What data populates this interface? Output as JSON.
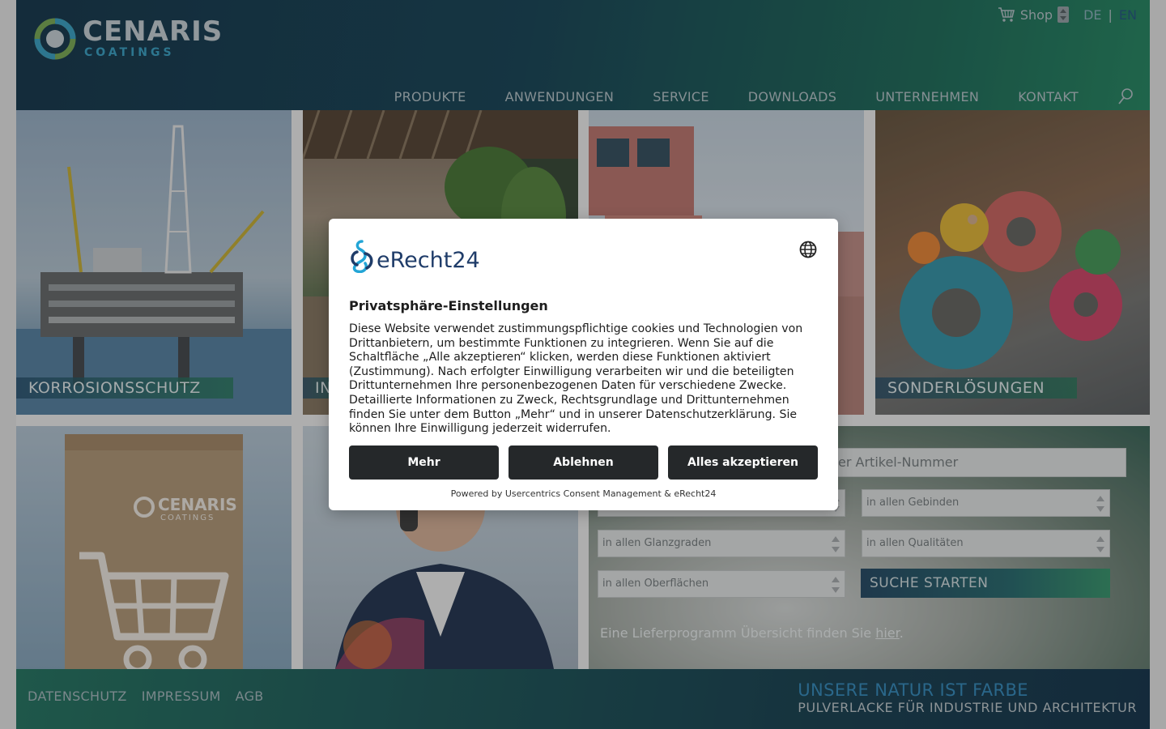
{
  "brand": {
    "name": "CENARIS",
    "sub": "COATINGS",
    "colors": {
      "header_dark": "#1d3d52",
      "header_green": "#2c8c68",
      "accent_blue": "#3b8fc0"
    }
  },
  "topbar": {
    "shop_label": "Shop",
    "lang_de": "DE",
    "lang_sep": "|",
    "lang_en": "EN"
  },
  "nav": {
    "items": [
      "PRODUKTE",
      "ANWENDUNGEN",
      "SERVICE",
      "DOWNLOADS",
      "UNTERNEHMEN",
      "KONTAKT"
    ]
  },
  "tiles": {
    "korrosion": "KORROSIONSSCHUTZ",
    "innen_partial": "IN",
    "sonder": "SONDERLÖSUNGEN",
    "box_brand": "CENARIS",
    "box_sub": "COATINGS"
  },
  "search": {
    "main_placeholder_visible": "ne oder Artikel-Nummer",
    "gebinde": "in allen Gebinden",
    "glanz": "in allen Glanzgraden",
    "qualitaet": "in allen Qualitäten",
    "oberflaeche": "in allen Oberflächen",
    "button": "SUCHE STARTEN",
    "note_prefix": "Eine Lieferprogramm Übersicht finden Sie ",
    "note_link": "hier",
    "note_suffix": "."
  },
  "footer": {
    "links": [
      "DATENSCHUTZ",
      "IMPRESSUM",
      "AGB"
    ],
    "slogan_1": "UNSERE NATUR IST FARBE",
    "slogan_2": "PULVERLACKE FÜR INDUSTRIE UND ARCHITEKTUR"
  },
  "consent": {
    "logo_text": "eRecht24",
    "title": "Privatsphäre-Einstellungen",
    "body": "Diese Website verwendet zustimmungspflichtige cookies und Technologien von Drittanbietern, um bestimmte Funktionen zu integrieren. Wenn Sie auf die Schaltfläche „Alle akzeptieren“ klicken, werden diese Funktionen aktiviert (Zustimmung). Nach erfolgter Einwilligung verarbeiten wir und die beteiligten Drittunternehmen Ihre personenbezogenen Daten für verschiedene Zwecke. Detaillierte Informationen zu Zweck, Rechtsgrundlage und Drittunternehmen finden Sie unter dem Button „Mehr“ und in unserer Datenschutzerklärung. Sie können Ihre Einwilligung jederzeit widerrufen.",
    "btn_more": "Mehr",
    "btn_decline": "Ablehnen",
    "btn_accept": "Alles akzeptieren",
    "powered": "Powered by Usercentrics Consent Management & eRecht24"
  }
}
